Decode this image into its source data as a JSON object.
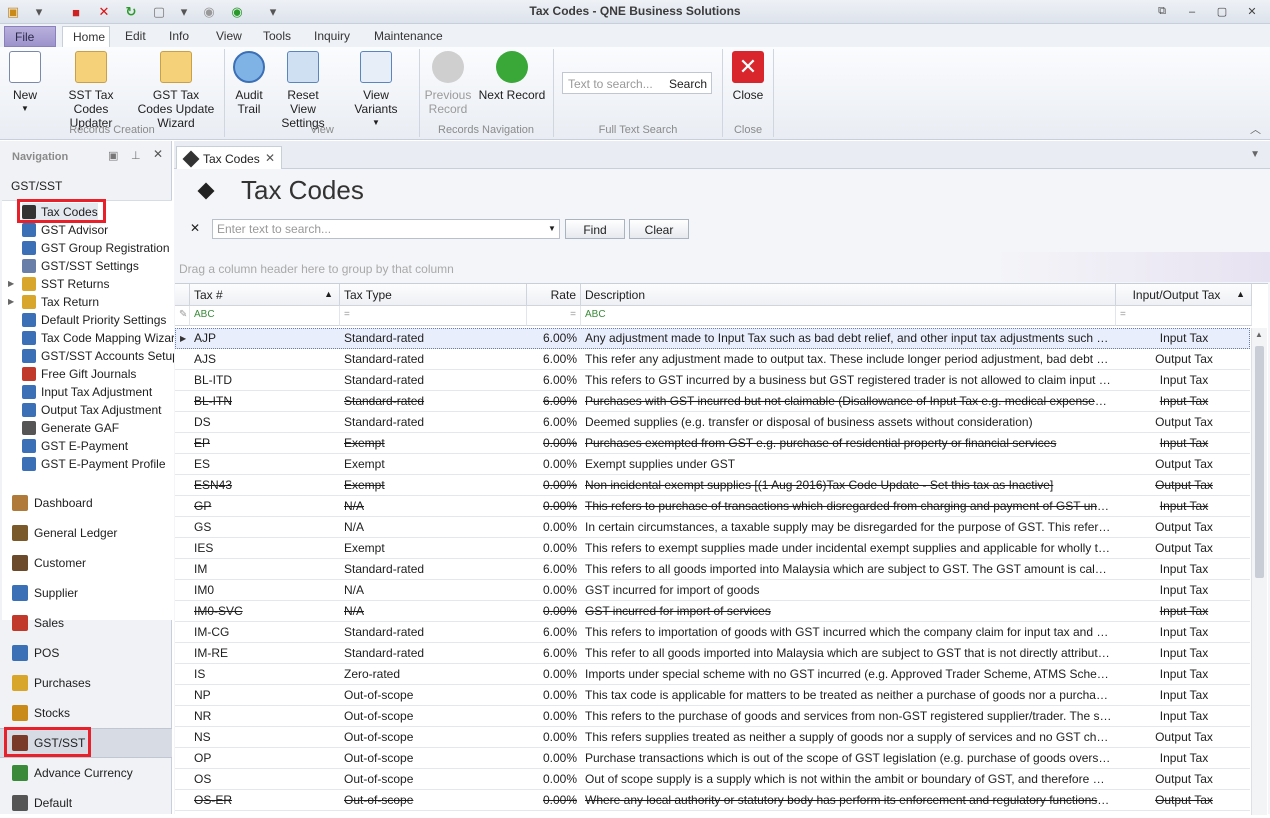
{
  "app": {
    "title": "Tax Codes - QNE Business Solutions"
  },
  "ribbon": {
    "tabs": [
      "File",
      "Home",
      "Edit",
      "Info",
      "View",
      "Tools",
      "Inquiry",
      "Maintenance"
    ],
    "buttons": {
      "new": "New",
      "sst_updater": "SST Tax Codes Updater",
      "gst_wizard": "GST Tax Codes Update Wizard",
      "audit_trail": "Audit Trail",
      "reset_view": "Reset View Settings",
      "view_variants": "View Variants",
      "previous_record": "Previous Record",
      "next_record": "Next Record",
      "close": "Close"
    },
    "search": {
      "placeholder": "Text to search...",
      "button": "Search"
    },
    "groups": {
      "records_creation": "Records Creation",
      "view": "View",
      "records_navigation": "Records Navigation",
      "full_text_search": "Full Text Search",
      "close": "Close"
    }
  },
  "navigation": {
    "header": "Navigation",
    "section": "GST/SST",
    "tree": [
      "Tax Codes",
      "GST Advisor",
      "GST Group Registration",
      "GST/SST Settings",
      "SST Returns",
      "Tax Return",
      "Default Priority Settings",
      "Tax Code Mapping Wizard",
      "GST/SST Accounts Setup",
      "Free Gift Journals",
      "Input Tax Adjustment",
      "Output Tax Adjustment",
      "Generate GAF",
      "GST E-Payment",
      "GST E-Payment Profile"
    ],
    "modules": [
      "Dashboard",
      "General Ledger",
      "Customer",
      "Supplier",
      "Sales",
      "POS",
      "Purchases",
      "Stocks",
      "GST/SST",
      "Advance Currency",
      "Default"
    ]
  },
  "document": {
    "tab": "Tax Codes",
    "title": "Tax Codes",
    "search_placeholder": "Enter text to search...",
    "find": "Find",
    "clear": "Clear",
    "group_hint": "Drag a column header here to group by that column",
    "columns": {
      "tax": "Tax #",
      "type": "Tax Type",
      "rate": "Rate",
      "desc": "Description",
      "io": "Input/Output Tax"
    },
    "filter_abc": "ABC",
    "filter_eq": "="
  },
  "rows": [
    {
      "code": "AJP",
      "type": "Standard-rated",
      "rate": "6.00%",
      "desc": "Any adjustment made to Input Tax such as bad debt relief, and other input tax adjustments such as longer...",
      "io": "Input Tax",
      "struck": false
    },
    {
      "code": "AJS",
      "type": "Standard-rated",
      "rate": "6.00%",
      "desc": "This refer any adjustment made to output tax. These include longer period adjustment, bad debt recovered...",
      "io": "Output Tax",
      "struck": false
    },
    {
      "code": "BL-ITD",
      "type": "Standard-rated",
      "rate": "6.00%",
      "desc": "This refers to GST incurred by a business but GST registered trader is not allowed to claim input tax incurred...",
      "io": "Input Tax",
      "struck": false
    },
    {
      "code": "BL-ITN",
      "type": "Standard-rated",
      "rate": "6.00%",
      "desc": "Purchases with GST incurred but not claimable (Disallowance of Input Tax e.g. medical expenses for staff)",
      "io": "Input Tax",
      "struck": true
    },
    {
      "code": "DS",
      "type": "Standard-rated",
      "rate": "6.00%",
      "desc": "Deemed supplies (e.g. transfer or disposal of business assets without consideration)",
      "io": "Output Tax",
      "struck": false
    },
    {
      "code": "EP",
      "type": "Exempt",
      "rate": "0.00%",
      "desc": "Purchases exempted from GST e.g. purchase of residential property or financial services",
      "io": "Input Tax",
      "struck": true
    },
    {
      "code": "ES",
      "type": "Exempt",
      "rate": "0.00%",
      "desc": "Exempt supplies under GST",
      "io": "Output Tax",
      "struck": false
    },
    {
      "code": "ESN43",
      "type": "Exempt",
      "rate": "0.00%",
      "desc": "Non incidental exempt supplies [(1 Aug 2016)Tax Code Update - Set this tax as Inactive]",
      "io": "Output Tax",
      "struck": true
    },
    {
      "code": "GP",
      "type": "N/A",
      "rate": "0.00%",
      "desc": "This refers to purchase of transactions which disregarded from charging and payment of GST under GST legi...",
      "io": "Input Tax",
      "struck": true
    },
    {
      "code": "GS",
      "type": "N/A",
      "rate": "0.00%",
      "desc": "In certain circumstances, a taxable supply may be disregarded for the purpose of GST. This refers to suppli...",
      "io": "Output Tax",
      "struck": false
    },
    {
      "code": "IES",
      "type": "Exempt",
      "rate": "0.00%",
      "desc": "This refers to exempt supplies made under incidental exempt supplies and applicable for wholly taxable supp...",
      "io": "Output Tax",
      "struck": false
    },
    {
      "code": "IM",
      "type": "Standard-rated",
      "rate": "6.00%",
      "desc": "This refers to all goods imported into Malaysia which are subject to GST. The GST amount is calculated on th...",
      "io": "Input Tax",
      "struck": false
    },
    {
      "code": "IM0",
      "type": "N/A",
      "rate": "0.00%",
      "desc": "GST incurred for import of goods",
      "io": "Input Tax",
      "struck": false
    },
    {
      "code": "IM0-SVC",
      "type": "N/A",
      "rate": "0.00%",
      "desc": "GST incurred for import of services",
      "io": "Input Tax",
      "struck": true
    },
    {
      "code": "IM-CG",
      "type": "Standard-rated",
      "rate": "6.00%",
      "desc": "This refers to importation of goods with GST incurred which the company claim for input tax and capitalize th...",
      "io": "Input Tax",
      "struck": false
    },
    {
      "code": "IM-RE",
      "type": "Standard-rated",
      "rate": "6.00%",
      "desc": "This refer to all goods imported into Malaysia which are subject to GST that is not directly attributable to tax...",
      "io": "Input Tax",
      "struck": false
    },
    {
      "code": "IS",
      "type": "Zero-rated",
      "rate": "0.00%",
      "desc": "Imports under special scheme with no GST incurred (e.g. Approved Trader Scheme, ATMS Scheme)",
      "io": "Input Tax",
      "struck": false
    },
    {
      "code": "NP",
      "type": "Out-of-scope",
      "rate": "0.00%",
      "desc": "This tax code is applicable for matters to be treated as neither a purchase of goods nor a purchase of servi...",
      "io": "Input Tax",
      "struck": false
    },
    {
      "code": "NR",
      "type": "Out-of-scope",
      "rate": "0.00%",
      "desc": "This refers to the purchase of goods and services from non-GST registered supplier/trader.  The supplier/tr...",
      "io": "Input Tax",
      "struck": false
    },
    {
      "code": "NS",
      "type": "Out-of-scope",
      "rate": "0.00%",
      "desc": "This refers supplies treated as neither a supply of goods nor a supply of services and no GST chargeable. B...",
      "io": "Output Tax",
      "struck": false
    },
    {
      "code": "OP",
      "type": "Out-of-scope",
      "rate": "0.00%",
      "desc": "Purchase transactions which is out of the scope of GST legislation (e.g. purchase of goods overseas)",
      "io": "Input Tax",
      "struck": false
    },
    {
      "code": "OS",
      "type": "Out-of-scope",
      "rate": "0.00%",
      "desc": "Out of scope supply is a supply which is not within the ambit or boundary of GST, and therefore GST is not c...",
      "io": "Output Tax",
      "struck": false
    },
    {
      "code": "OS-ER",
      "type": "Out-of-scope",
      "rate": "0.00%",
      "desc": "Where any local authority or statutory body has perform its enforcement and regulatory functions, the stat...",
      "io": "Output Tax",
      "struck": true
    }
  ],
  "colors": {
    "highlight": "#e8202a",
    "accent": "#3b6fb6"
  }
}
